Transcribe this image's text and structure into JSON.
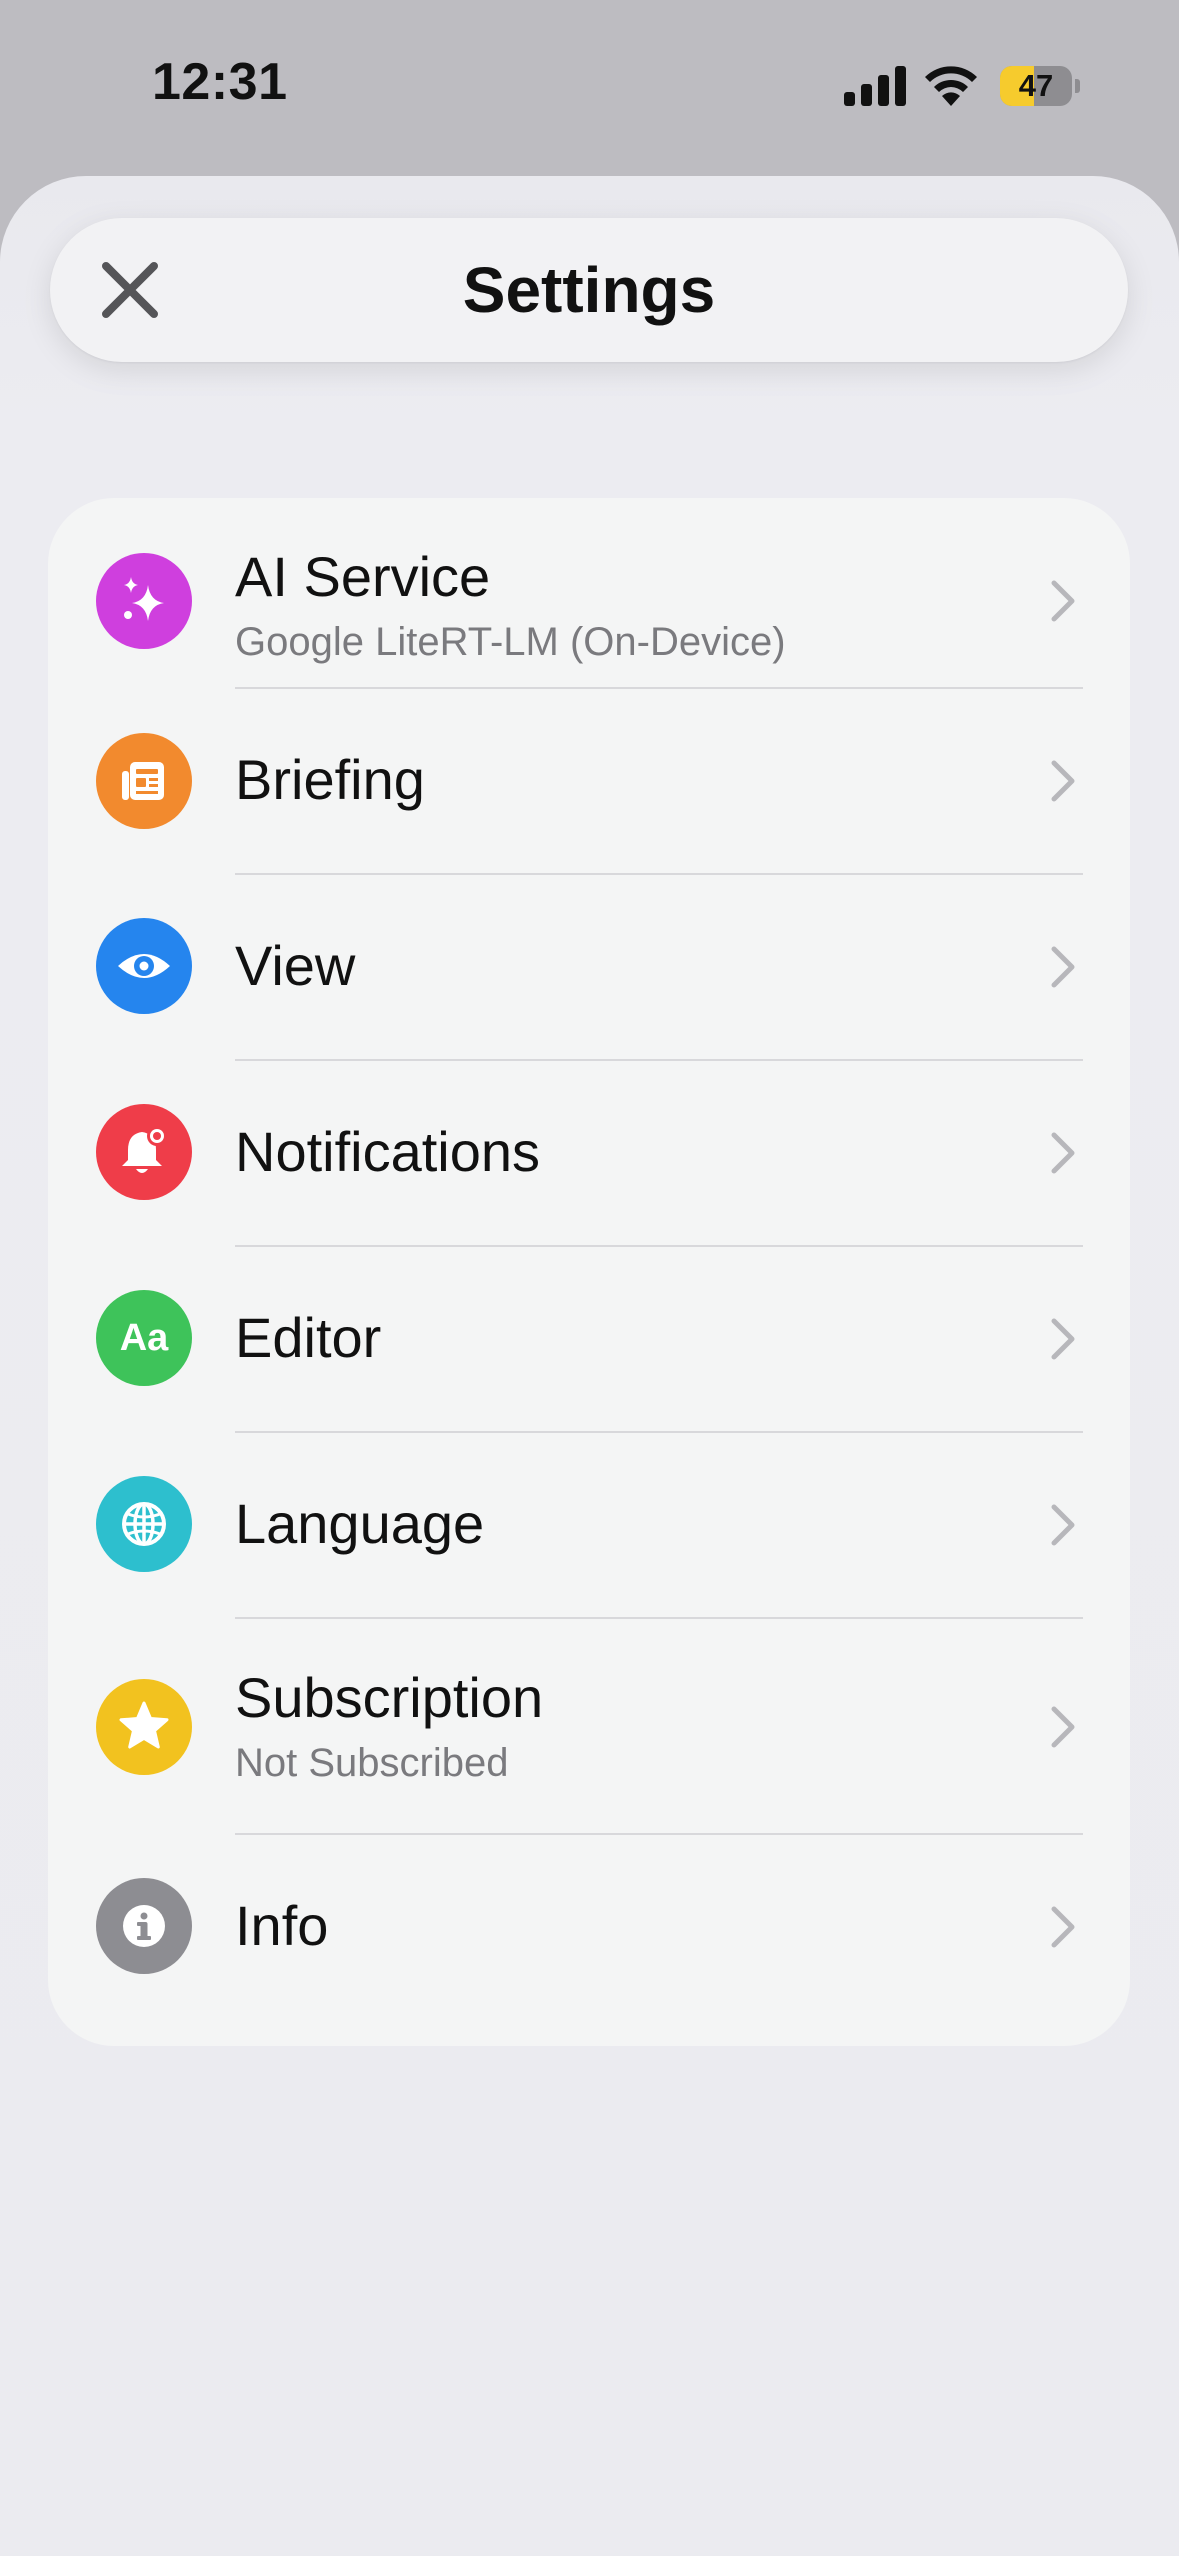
{
  "status_bar": {
    "time": "12:31",
    "battery_level": "47",
    "battery_fraction": 0.47
  },
  "nav": {
    "title": "Settings",
    "close_icon": "close-icon"
  },
  "settings": {
    "items": [
      {
        "key": "ai-service",
        "title": "AI Service",
        "subtitle": "Google LiteRT-LM (On-Device)",
        "icon": "sparkles-icon",
        "color": "#cf3fde"
      },
      {
        "key": "briefing",
        "title": "Briefing",
        "subtitle": "",
        "icon": "newspaper-icon",
        "color": "#f28a2e"
      },
      {
        "key": "view",
        "title": "View",
        "subtitle": "",
        "icon": "eye-icon",
        "color": "#2585ee"
      },
      {
        "key": "notifications",
        "title": "Notifications",
        "subtitle": "",
        "icon": "bell-badge-icon",
        "color": "#ef3d49"
      },
      {
        "key": "editor",
        "title": "Editor",
        "subtitle": "",
        "icon": "text-format-icon",
        "color": "#3ec35a"
      },
      {
        "key": "language",
        "title": "Language",
        "subtitle": "",
        "icon": "globe-icon",
        "color": "#2dbfce"
      },
      {
        "key": "subscription",
        "title": "Subscription",
        "subtitle": "Not Subscribed",
        "icon": "star-icon",
        "color": "#f2c21f"
      },
      {
        "key": "info",
        "title": "Info",
        "subtitle": "",
        "icon": "info-icon",
        "color": "#8d8d92"
      }
    ]
  }
}
